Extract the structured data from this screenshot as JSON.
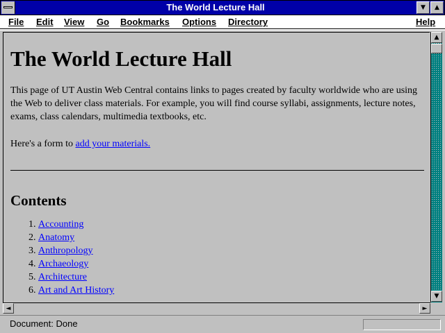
{
  "window": {
    "title": "The World Lecture Hall"
  },
  "menu": {
    "file": "File",
    "edit": "Edit",
    "view": "View",
    "go": "Go",
    "bookmarks": "Bookmarks",
    "options": "Options",
    "directory": "Directory",
    "help": "Help"
  },
  "page": {
    "heading": "The World Lecture Hall",
    "intro": "This page of UT Austin Web Central contains links to pages created by faculty worldwide who are using the Web to deliver class materials. For example, you will find course syllabi, assignments, lecture notes, exams, class calendars, multimedia textbooks, etc.",
    "form_prefix": "Here's a form to ",
    "form_link": "add your materials.",
    "contents_heading": "Contents",
    "contents": [
      "Accounting",
      "Anatomy",
      "Anthropology",
      "Archaeology",
      "Architecture",
      "Art and Art History"
    ]
  },
  "status": {
    "text": "Document: Done"
  },
  "icons": {
    "minimize": "minimize-icon",
    "maximize": "maximize-icon",
    "scroll_up": "arrow-up-icon",
    "scroll_down": "arrow-down-icon",
    "scroll_left": "arrow-left-icon",
    "scroll_right": "arrow-right-icon"
  },
  "colors": {
    "titlebar": "#0000a8",
    "link": "#0000ff",
    "background": "#c0c0c0"
  }
}
